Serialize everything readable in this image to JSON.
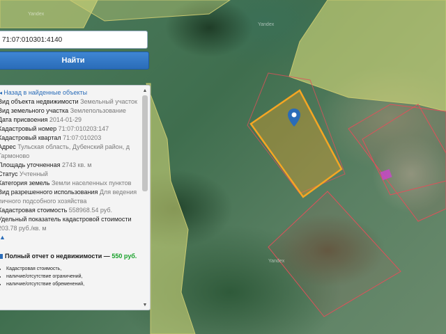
{
  "search": {
    "value": "71:07:010301:4140"
  },
  "find_button": {
    "label": "Найти"
  },
  "panel": {
    "back_link": "Назад в найденные объекты",
    "rows": [
      {
        "label": "Вид объекта недвижимости",
        "value": "Земельный участок"
      },
      {
        "label": "Вид земельного участка",
        "value": "Землепользование"
      },
      {
        "label": "Дата присвоения",
        "value": "2014-01-29"
      },
      {
        "label": "Кадастровый номер",
        "value": "71:07:010203:147"
      },
      {
        "label": "Кадастровый квартал",
        "value": "71:07:010203"
      },
      {
        "label": "Адрес",
        "value": "Тульская область, Дубенский район, д Гармоново"
      },
      {
        "label": "Площадь уточненная",
        "value": "2743 кв. м"
      },
      {
        "label": "Статус",
        "value": "Учтенный"
      },
      {
        "label": "Категория земель",
        "value": "Земли населенных пунктов"
      },
      {
        "label": "Вид разрешенного использования",
        "value": "Для ведения личного подсобного хозяйства"
      },
      {
        "label": "Кадастровая стоимость",
        "value": "558968.54 руб."
      },
      {
        "label": "Удельный показатель кадастровой стоимости",
        "value": "203.78 руб./кв. м"
      }
    ],
    "more_arrow": "▲",
    "report": {
      "title": "Полный отчет о недвижимости —",
      "price": "550 руб.",
      "items": [
        "Кадастровая стоимость,",
        "наличие/отсутствие ограничений,",
        "наличие/отсутствие обременений,"
      ]
    }
  },
  "map": {
    "watermarks": [
      "Yandex",
      "Yandex",
      "Yandex"
    ],
    "colors": {
      "selected_parcel_stroke": "#f5a623",
      "selected_parcel_fill": "#f5a623",
      "neighbor_parcel_stroke": "#e0505a",
      "zone_fill": "#d8dc7a",
      "marker": "#2a6cb8",
      "building": "#cc44cc"
    }
  }
}
